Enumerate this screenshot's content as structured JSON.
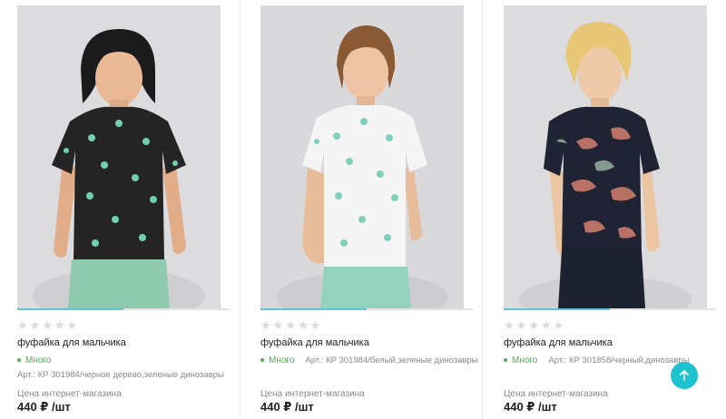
{
  "products": [
    {
      "title": "фуфайка для мальчика",
      "stock": "",
      "article": "Арт.: КР 301984/черное дерево,зеленые динозавры",
      "price_label": "Цена интернет-магазина",
      "price": "440 ₽ /шт",
      "rating": 0,
      "slider_progress": 0.5,
      "image": "boy-black-dino-tshirt"
    },
    {
      "title": "фуфайка для мальчика",
      "stock": "Много",
      "article": "Арт.: КР 301984/белый,зеленые динозавры",
      "price_label": "Цена интернет-магазина",
      "price": "440 ₽ /шт",
      "rating": 0,
      "slider_progress": 0.5,
      "image": "boy-white-dino-tshirt"
    },
    {
      "title": "фуфайка для мальчика",
      "stock": "Много",
      "article": "Арт.: КР 301858/черный,динозавры",
      "price_label": "Цена интернет-магазина",
      "price": "440 ₽ /шт",
      "rating": 0,
      "slider_progress": 0.5,
      "image": "boy-navy-dino-tshirt"
    }
  ],
  "first_card_stock": "Много",
  "star_glyph": "★",
  "scroll_top_icon": "arrow-up-icon",
  "colors": {
    "accent": "#1fc3d0",
    "slider": "#5ec7d4",
    "in_stock": "#4caf50"
  }
}
